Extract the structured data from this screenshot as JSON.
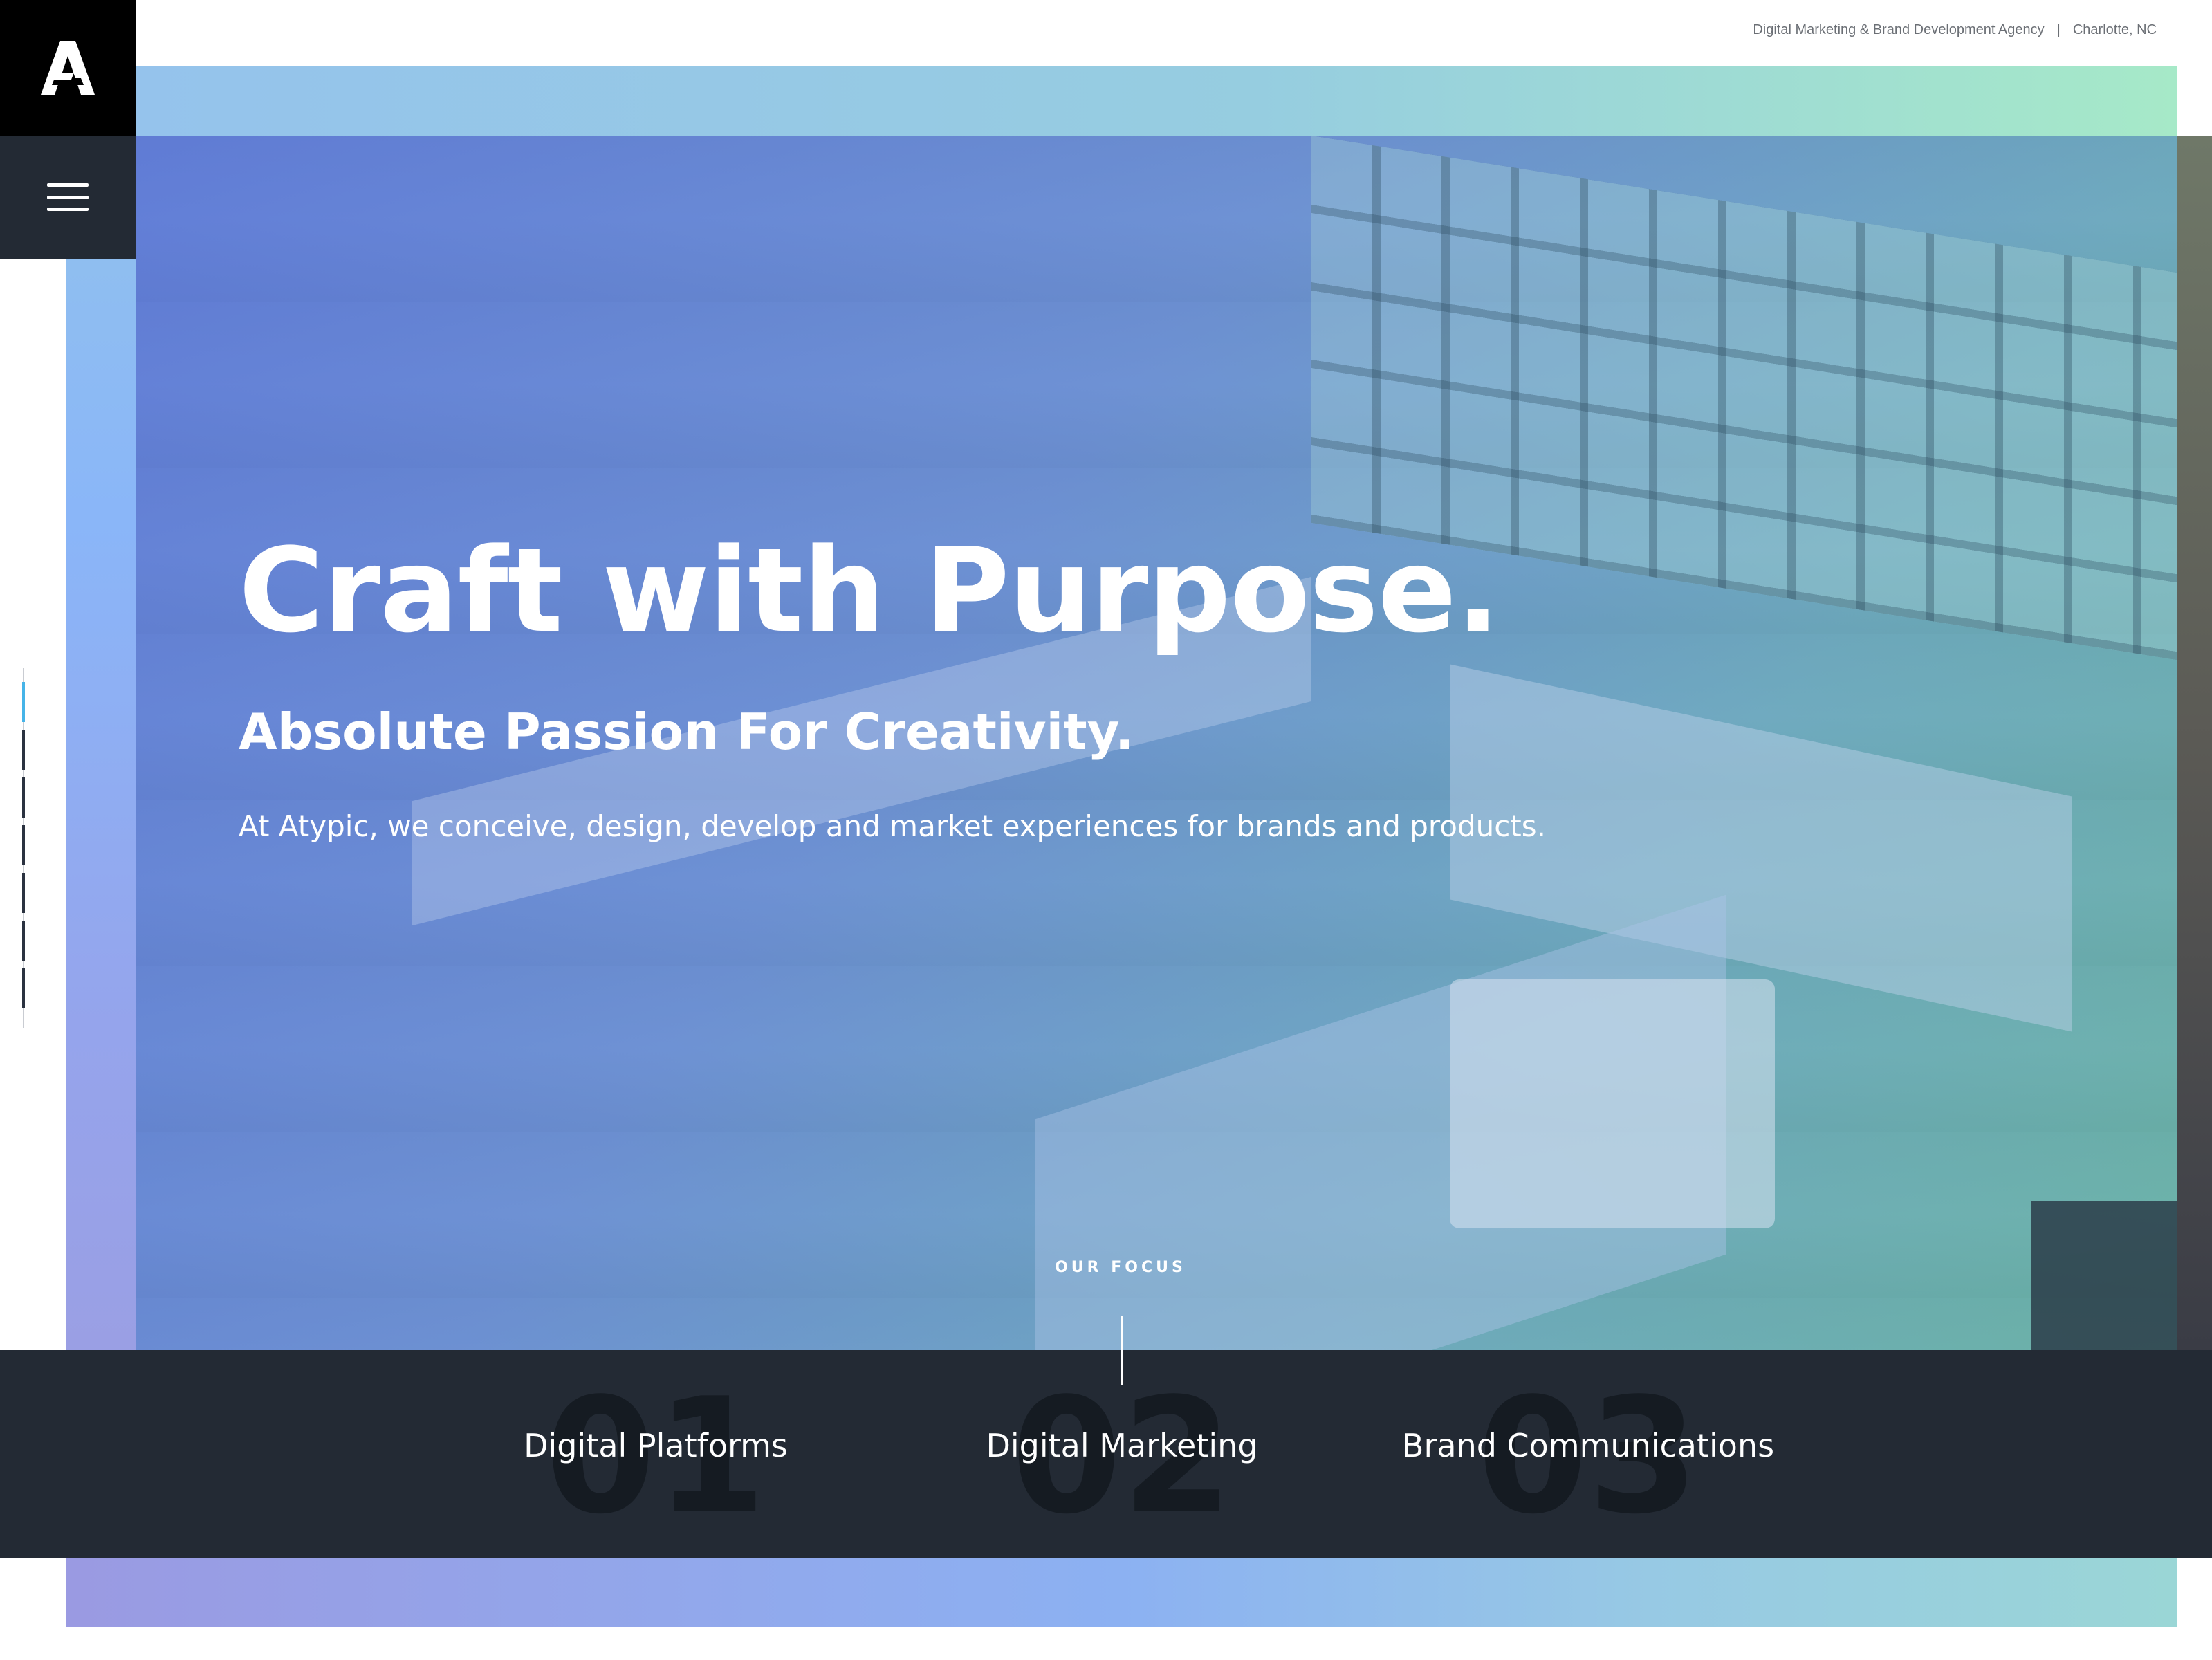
{
  "brand": {
    "logo_letter": "A",
    "logo_icon": "atypic-logo-icon"
  },
  "header": {
    "tagline": "Digital Marketing & Brand Development Agency",
    "separator": "|",
    "location": "Charlotte, NC",
    "menu_icon": "hamburger-menu-icon"
  },
  "hero": {
    "title": "Craft with Purpose.",
    "subtitle": "Absolute Passion For Creativity.",
    "description": "At Atypic, we conceive, design, develop and market experiences for brands and products."
  },
  "slides": {
    "count": 7,
    "active_index": 0,
    "active_color": "#46b4e8",
    "inactive_color": "#2a3240"
  },
  "focus": {
    "label": "OUR FOCUS",
    "items": [
      {
        "number": "01",
        "title": "Digital Platforms"
      },
      {
        "number": "02",
        "title": "Digital Marketing"
      },
      {
        "number": "03",
        "title": "Brand Communications"
      }
    ]
  },
  "colors": {
    "dark_panel": "#232a34",
    "gradient_blue": "#8ab6f8",
    "gradient_green": "#a6e9c8",
    "gradient_purple": "#9a9fe4"
  }
}
